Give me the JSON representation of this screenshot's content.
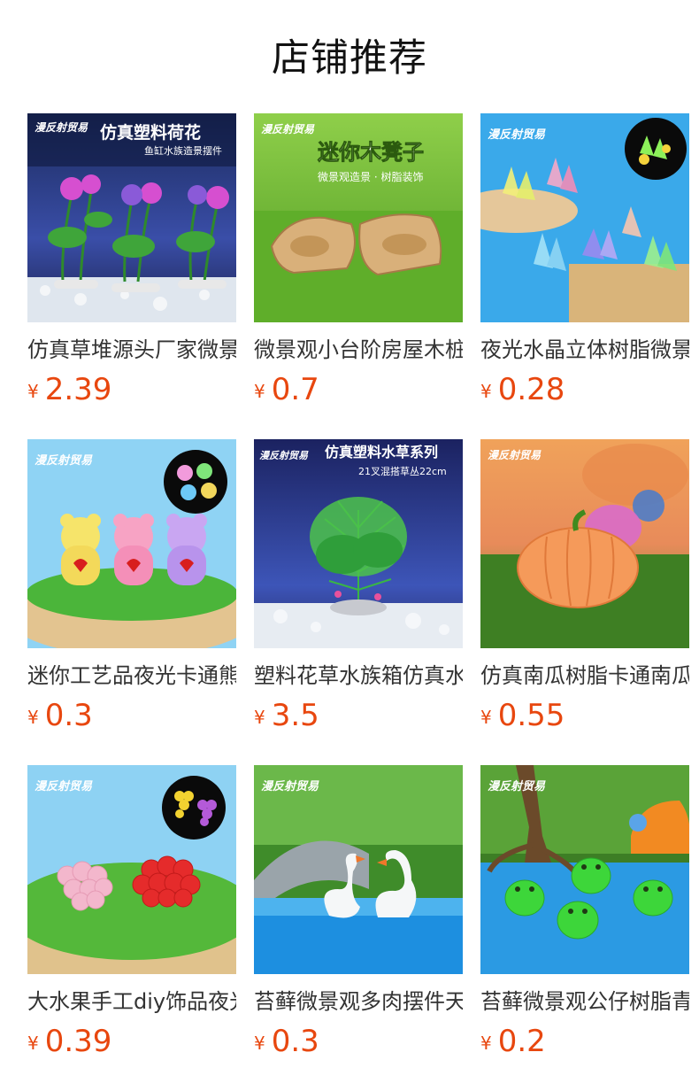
{
  "header": {
    "title": "店铺推荐"
  },
  "currency_symbol": "¥",
  "brand_watermark": "漫反射贸易",
  "products": [
    {
      "name": "仿真草堆源头厂家微景观",
      "price": "2.39",
      "overlay": {
        "title": "仿真塑料荷花",
        "subtitle": "鱼缸水族造景摆件"
      }
    },
    {
      "name": "微景观小台阶房屋木桩",
      "price": "0.7",
      "overlay": {
        "title": "迷你木凳子",
        "subtitle": "微景观造景 · 树脂装饰"
      }
    },
    {
      "name": "夜光水晶立体树脂微景观",
      "price": "0.28"
    },
    {
      "name": "迷你工艺品夜光卡通熊",
      "price": "0.3"
    },
    {
      "name": "塑料花草水族箱仿真水草",
      "price": "3.5",
      "overlay": {
        "title": "仿真塑料水草系列",
        "subtitle": "21叉混搭草丛22cm"
      }
    },
    {
      "name": "仿真南瓜树脂卡通南瓜",
      "price": "0.55"
    },
    {
      "name": "大水果手工diy饰品夜光",
      "price": "0.39"
    },
    {
      "name": "苔藓微景观多肉摆件天鹅",
      "price": "0.3"
    },
    {
      "name": "苔藓微景观公仔树脂青蛙",
      "price": "0.2"
    }
  ]
}
